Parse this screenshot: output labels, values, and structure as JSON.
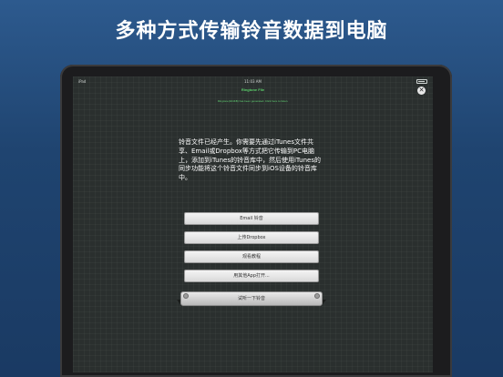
{
  "headline": "多种方式传输铃音数据到电脑",
  "status": {
    "carrier": "iPad",
    "time": "11:03 AM"
  },
  "navbar": {
    "title": "Ringtone File",
    "close_symbol": "✕"
  },
  "banner": "Ringtone(324KB) has been generated. Click here to listen.",
  "message": "铃音文件已经产生。你需要先通过iTunes文件共享、Email或Dropbox等方式把它传输到PC电脑上，添加到iTunes的铃音库中，然后使用iTunes的同步功能将这个铃音文件同步到iOS设备的铃音库中。",
  "buttons": {
    "email": "Email 铃音",
    "dropbox": "上传Dropbox",
    "tutorial": "观看教程",
    "share": "用其他App打开...",
    "primary": "试听一下铃音"
  }
}
